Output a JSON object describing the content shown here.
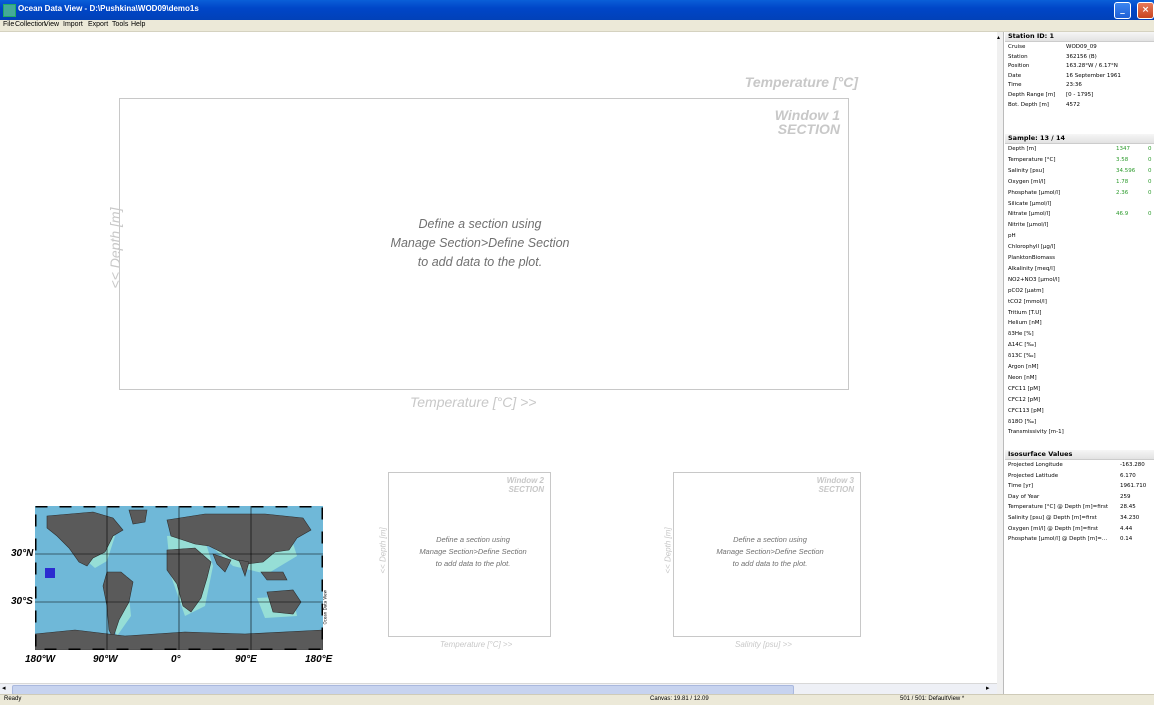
{
  "titlebar": {
    "title": "Ocean Data View - D:\\Pushkina\\WOD09\\demo1s",
    "min": "_",
    "max": "□",
    "close": "×"
  },
  "menu": [
    "File",
    "Collection",
    "View",
    "Import",
    "Export",
    "Tools",
    "Help"
  ],
  "window1": {
    "var": "Temperature [°C]",
    "title_line1": "Window 1",
    "title_line2": "SECTION",
    "y_label": "<< Depth [m]",
    "x_label": "Temperature [°C] >>",
    "msg1": "Define a section using",
    "msg2": "Manage Section>Define Section",
    "msg3": "to add data to the plot."
  },
  "window2": {
    "title_line1": "Window 2",
    "title_line2": "SECTION",
    "y_label": "<< Depth [m]",
    "x_label": "Temperature [°C] >>",
    "msg1": "Define a section using",
    "msg2": "Manage Section>Define Section",
    "msg3": "to add data to the plot."
  },
  "window3": {
    "title_line1": "Window 3",
    "title_line2": "SECTION",
    "y_label": "<< Depth [m]",
    "x_label": "Salinity [psu] >>",
    "msg1": "Define a section using",
    "msg2": "Manage Section>Define Section",
    "msg3": "to add data to the plot."
  },
  "map": {
    "x_labels": [
      "180°W",
      "90°W",
      "0°",
      "90°E",
      "180°E"
    ],
    "y_labels": [
      "30°N",
      "30°S"
    ],
    "credit": "Ocean Data View",
    "colors": {
      "land": "#5a5a5a",
      "ocean": "#6fb8d8",
      "shelf": "#9be3d6",
      "marker": "#2b2bd0"
    }
  },
  "station": {
    "header": "Station ID: 1",
    "rows": [
      {
        "k": "Cruise",
        "v": "WOD09_09"
      },
      {
        "k": "Station",
        "v": "362156 (B)"
      },
      {
        "k": "Position",
        "v": "163.28°W / 6.17°N"
      },
      {
        "k": "Date",
        "v": "16 September 1961"
      },
      {
        "k": "Time",
        "v": "23:36"
      },
      {
        "k": "Depth Range [m]",
        "v": "[0 - 1795]"
      },
      {
        "k": "Bot. Depth [m]",
        "v": "4572"
      }
    ]
  },
  "sample": {
    "header": "Sample: 13 / 14",
    "rows": [
      {
        "k": "Depth [m]",
        "v": "1347",
        "f": "0"
      },
      {
        "k": "Temperature [°C]",
        "v": "3.58",
        "f": "0"
      },
      {
        "k": "Salinity [psu]",
        "v": "34.596",
        "f": "0"
      },
      {
        "k": "Oxygen [ml/l]",
        "v": "1.78",
        "f": "0"
      },
      {
        "k": "Phosphate [µmol/l]",
        "v": "2.36",
        "f": "0"
      },
      {
        "k": "Silicate [µmol/l]",
        "v": "",
        "f": ""
      },
      {
        "k": "Nitrate [µmol/l]",
        "v": "46.9",
        "f": "0"
      },
      {
        "k": "Nitrite [µmol/l]",
        "v": "",
        "f": ""
      },
      {
        "k": "pH",
        "v": "",
        "f": ""
      },
      {
        "k": "Chlorophyll [µg/l]",
        "v": "",
        "f": ""
      },
      {
        "k": "PlanktonBiomass",
        "v": "",
        "f": ""
      },
      {
        "k": "Alkalinity [meq/l]",
        "v": "",
        "f": ""
      },
      {
        "k": "NO2+NO3 [µmol/l]",
        "v": "",
        "f": ""
      },
      {
        "k": "pCO2 [µatm]",
        "v": "",
        "f": ""
      },
      {
        "k": "tCO2 [mmol/l]",
        "v": "",
        "f": ""
      },
      {
        "k": "Tritium [T.U]",
        "v": "",
        "f": ""
      },
      {
        "k": "Helium [nM]",
        "v": "",
        "f": ""
      },
      {
        "k": "δ3He [%]",
        "v": "",
        "f": ""
      },
      {
        "k": "Δ14C [‰]",
        "v": "",
        "f": ""
      },
      {
        "k": "δ13C [‰]",
        "v": "",
        "f": ""
      },
      {
        "k": "Argon [nM]",
        "v": "",
        "f": ""
      },
      {
        "k": "Neon [nM]",
        "v": "",
        "f": ""
      },
      {
        "k": "CFC11 [pM]",
        "v": "",
        "f": ""
      },
      {
        "k": "CFC12 [pM]",
        "v": "",
        "f": ""
      },
      {
        "k": "CFC113 [pM]",
        "v": "",
        "f": ""
      },
      {
        "k": "δ18O [‰]",
        "v": "",
        "f": ""
      },
      {
        "k": "Transmissivity [m-1]",
        "v": "",
        "f": ""
      }
    ]
  },
  "isosurface": {
    "header": "Isosurface Values",
    "rows": [
      {
        "k": "Projected Longitude",
        "v": "-163.280"
      },
      {
        "k": "Projected Latitude",
        "v": "6.170"
      },
      {
        "k": "Time [yr]",
        "v": "1961.710"
      },
      {
        "k": "Day of Year",
        "v": "259"
      },
      {
        "k": "Temperature [°C] @ Depth [m]=first",
        "v": "28.45"
      },
      {
        "k": "Salinity [psu] @ Depth [m]=first",
        "v": "34.230"
      },
      {
        "k": "Oxygen [ml/l] @ Depth [m]=first",
        "v": "4.44"
      },
      {
        "k": "Phosphate [µmol/l] @ Depth [m]=...",
        "v": "0.14"
      }
    ]
  },
  "status": {
    "left": "Ready",
    "canvas": "Canvas: 19.81 / 12.09",
    "right": "501 / 501: DefaultView *"
  }
}
